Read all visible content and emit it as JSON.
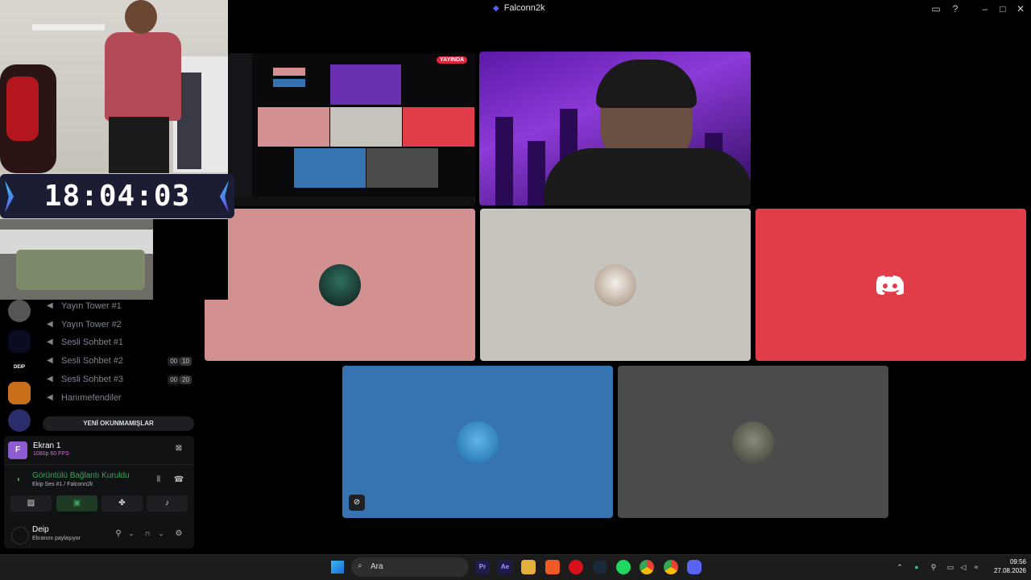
{
  "window": {
    "title": "Falconn2k"
  },
  "clock": {
    "time": "18:04:03"
  },
  "channels": [
    {
      "name": "Yayın Tower #1"
    },
    {
      "name": "Yayın Tower #2"
    },
    {
      "name": "Sesli Sohbet #1"
    },
    {
      "name": "Sesli Sohbet #2",
      "count_a": "00",
      "count_b": "10"
    },
    {
      "name": "Sesli Sohbet #3",
      "count_a": "00",
      "count_b": "20"
    },
    {
      "name": "Hanımefendiler"
    }
  ],
  "unread_banner": "YENİ OKUNMAMIŞLAR",
  "screen_share": {
    "avatar_letter": "F",
    "title": "Ekran 1",
    "quality": "1080p 60 FPS"
  },
  "connection": {
    "status": "Görüntülü Bağlantı Kuruldu",
    "location": "Ekip Ses #1 / Falconn2k"
  },
  "user": {
    "name": "Deip",
    "status": "Ekranını paylaşıyor"
  },
  "stream": {
    "live_badge": "YAYINDA"
  },
  "server_labels": {
    "deip": "DEIP"
  },
  "tiles": {
    "colors": [
      "#d29090",
      "#c6c4bd",
      "#e13d48",
      "#3574b1",
      "#4a4c4b"
    ],
    "discord_icon": "discord-logo-icon"
  },
  "taskbar": {
    "search_placeholder": "Ara",
    "apps": [
      "Pr",
      "Ae"
    ],
    "time": "09:56",
    "date": "27.08.2026"
  }
}
